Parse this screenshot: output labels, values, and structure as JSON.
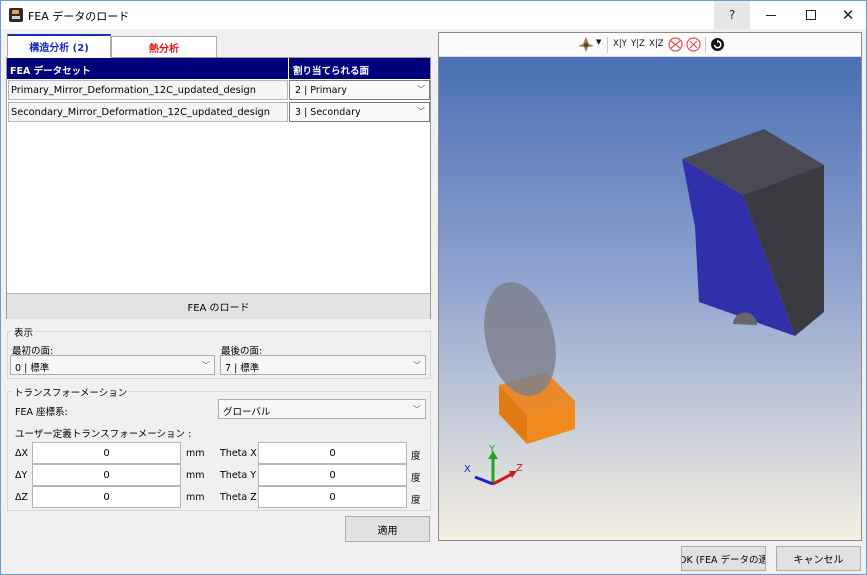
{
  "window": {
    "title": "FEA データのロード",
    "help": "?"
  },
  "tabs": [
    {
      "label": "構造分析 (2)",
      "color": "#1a2fc0"
    },
    {
      "label": "熱分析",
      "color": "#e01818"
    }
  ],
  "table": {
    "headers": [
      "FEA データセット",
      "割り当てられる面"
    ],
    "header_bg": "#00007a",
    "rows": [
      {
        "dataset": "Primary_Mirror_Deformation_12C_updated_design",
        "face": "2 | Primary"
      },
      {
        "dataset": "Secondary_Mirror_Deformation_12C_updated_design",
        "face": "3 | Secondary"
      }
    ],
    "load_button": "FEA のロード"
  },
  "display": {
    "group_label": "表示",
    "first_face_label": "最初の面:",
    "first_face_value": "0 | 標準",
    "last_face_label": "最後の面:",
    "last_face_value": "7 | 標準"
  },
  "transform": {
    "group_label": "トランスフォーメーション",
    "coord_label": "FEA 座標系:",
    "coord_value": "グローバル",
    "user_label": "ユーザー定義トランスフォーメーション :",
    "rows": [
      {
        "label": "ΔX",
        "value": "0",
        "unit": "mm",
        "theta_label": "Theta X",
        "theta_value": "0",
        "theta_unit": "度"
      },
      {
        "label": "ΔY",
        "value": "0",
        "unit": "mm",
        "theta_label": "Theta Y",
        "theta_value": "0",
        "theta_unit": "度"
      },
      {
        "label": "ΔZ",
        "value": "0",
        "unit": "mm",
        "theta_label": "Theta Z",
        "theta_value": "0",
        "theta_unit": "度"
      }
    ],
    "apply_button": "適用"
  },
  "viewer": {
    "toolbar": {
      "view_xy": "X|Y",
      "view_yz": "Y|Z",
      "view_xz": "X|Z"
    },
    "axes": {
      "x": "X",
      "y": "Y",
      "z": "Z"
    },
    "icons": [
      "camera-icon",
      "dropdown-arrow-icon",
      "rotate-x-icon",
      "rotate-z-icon",
      "reset-view-icon"
    ]
  },
  "footer": {
    "ok_button": "OK (FEA データの適",
    "cancel_button": "キャンセル"
  }
}
